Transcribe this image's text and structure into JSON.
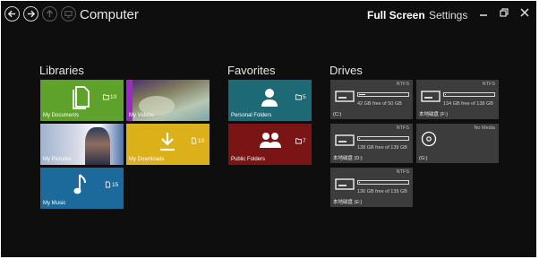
{
  "window": {
    "title": "Computer"
  },
  "header": {
    "menu": {
      "full_screen": "Full Screen",
      "settings": "Settings"
    }
  },
  "colors": {
    "documents": "#5fa22b",
    "downloads": "#dcb018",
    "music": "#1c6a9c",
    "personal": "#1d6a76",
    "public": "#7b1414",
    "drive_bg": "#3c3c3c"
  },
  "sections": {
    "libraries": "Libraries",
    "favorites": "Favorites",
    "drives": "Drives"
  },
  "libraries": [
    {
      "label": "My Documents",
      "count": "10",
      "icon": "document-icon"
    },
    {
      "label": "My Videos",
      "count": "",
      "icon": "video-thumbnail"
    },
    {
      "label": "My Pictures",
      "count": "",
      "icon": "picture-thumbnail"
    },
    {
      "label": "My Downloads",
      "count": "10",
      "icon": "download-icon"
    },
    {
      "label": "My Music",
      "count": "15",
      "icon": "music-note-icon"
    }
  ],
  "favorites": [
    {
      "label": "Personal Folders",
      "count": "5",
      "icon": "person-icon"
    },
    {
      "label": "Public Folders",
      "count": "7",
      "icon": "people-icon"
    }
  ],
  "drives": [
    {
      "name": "(C:)",
      "fs": "NTFS",
      "free": "42 GB free of 50 GB",
      "used_fraction": 0.16
    },
    {
      "name": "本地磁盘 (F:)",
      "fs": "NTFS",
      "free": "134 GB free of 138 GB",
      "used_fraction": 0.03
    },
    {
      "name": "本地磁盘 (D:)",
      "fs": "NTFS",
      "free": "138 GB free of 139 GB",
      "used_fraction": 0.01
    },
    {
      "name": "(G:)",
      "fs": "No Media",
      "free": "",
      "used_fraction": null
    },
    {
      "name": "本地磁盘 (E:)",
      "fs": "NTFS",
      "free": "136 GB free of 139 GB",
      "used_fraction": 0.02
    }
  ]
}
